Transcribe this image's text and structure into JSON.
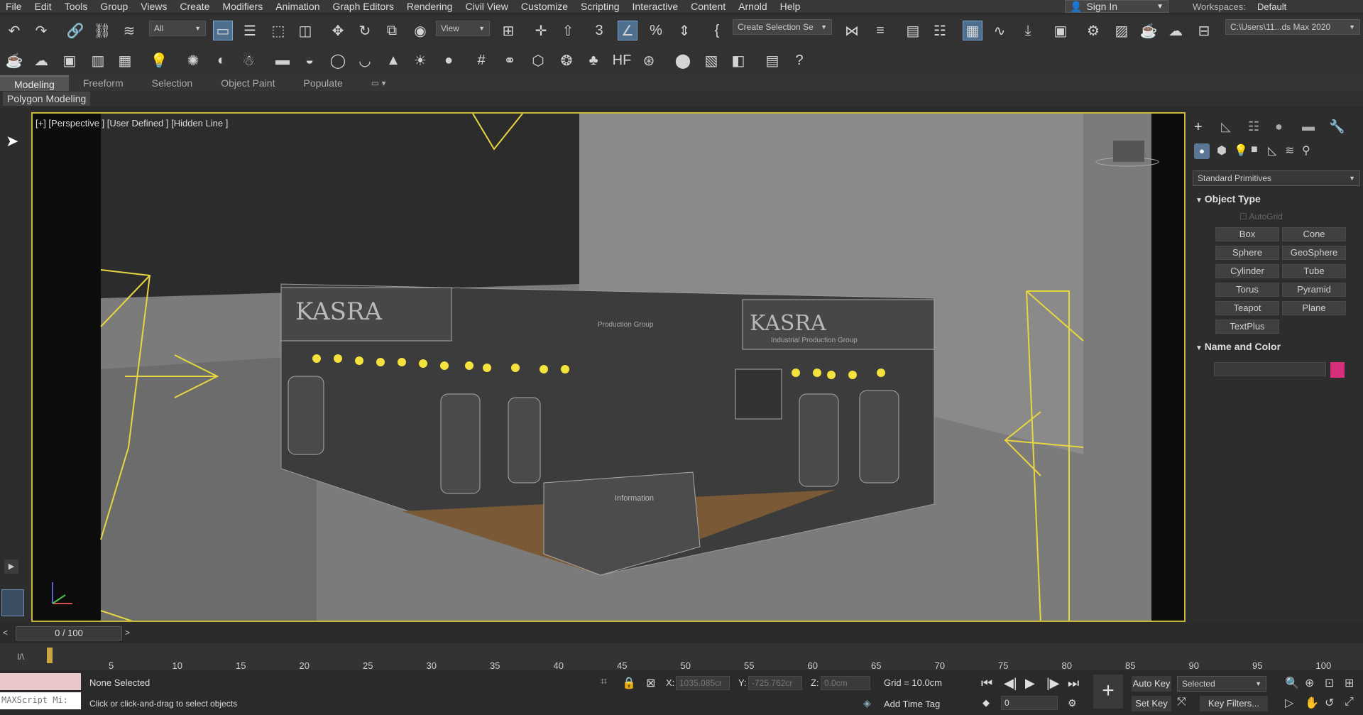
{
  "menu": [
    "File",
    "Edit",
    "Tools",
    "Group",
    "Views",
    "Create",
    "Modifiers",
    "Animation",
    "Graph Editors",
    "Rendering",
    "Civil View",
    "Customize",
    "Scripting",
    "Interactive",
    "Content",
    "Arnold",
    "Help"
  ],
  "signin": "Sign In",
  "workspace": {
    "label": "Workspaces:",
    "value": "Default"
  },
  "toolbar": {
    "filter": "All",
    "refcoord": "View",
    "selection_set": "Create Selection Se",
    "project_path": "C:\\Users\\11...ds Max 2020"
  },
  "ribbon": {
    "tabs": [
      "Modeling",
      "Freeform",
      "Selection",
      "Object Paint",
      "Populate"
    ],
    "active": "Modeling",
    "sub": "Polygon Modeling"
  },
  "viewport": {
    "label": "[+] [Perspective ] [User Defined ] [Hidden Line ]",
    "scene_text": [
      "KASRA",
      "KASRA",
      "Industrial Production Group",
      "Production Group",
      "Information"
    ]
  },
  "command_panel": {
    "category": "Standard Primitives",
    "object_type_title": "Object Type",
    "autogrid": "AutoGrid",
    "buttons": [
      "Box",
      "Cone",
      "Sphere",
      "GeoSphere",
      "Cylinder",
      "Tube",
      "Torus",
      "Pyramid",
      "Teapot",
      "Plane",
      "TextPlus"
    ],
    "name_color_title": "Name and Color",
    "swatch_color": "#d6307a"
  },
  "timeline": {
    "frame": "0 / 100",
    "ticks": [
      "5",
      "10",
      "15",
      "20",
      "25",
      "30",
      "35",
      "40",
      "45",
      "50",
      "55",
      "60",
      "65",
      "70",
      "75",
      "80",
      "85",
      "90",
      "95",
      "100"
    ]
  },
  "status": {
    "script": "MAXScript Mi:",
    "selected": "None Selected",
    "prompt": "Click or click-and-drag to select objects",
    "x_label": "X:",
    "x": "1035.085cr",
    "y_label": "Y:",
    "y": "-725.762cr",
    "z_label": "Z:",
    "z": "0.0cm",
    "grid": "Grid = 10.0cm",
    "add_time_tag": "Add Time Tag",
    "auto_key": "Auto Key",
    "set_key": "Set Key",
    "key_mode": "Selected",
    "key_filters": "Key Filters...",
    "current_frame": "0"
  }
}
